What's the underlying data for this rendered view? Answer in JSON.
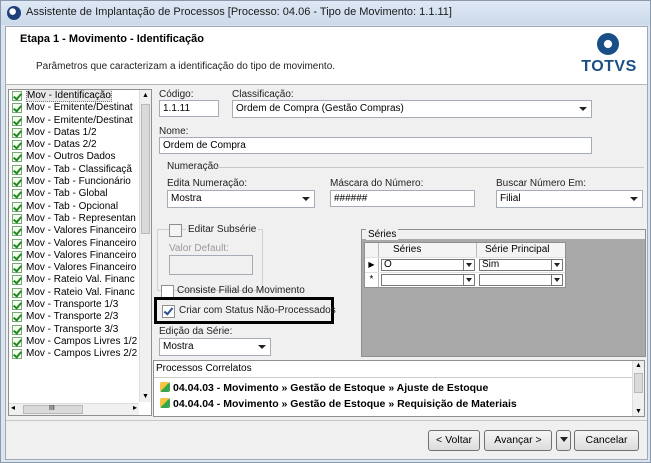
{
  "window": {
    "title": "Assistente de Implantação de Processos [Processo: 04.06 - Tipo de Movimento: 1.1.11]"
  },
  "header": {
    "stage_title": "Etapa 1 - Movimento - Identificação",
    "subtitle": "Parâmetros que caracterizam a identificação do tipo de movimento.",
    "logo_text": "TOTVS"
  },
  "nav": {
    "items": [
      {
        "label": "Mov - Identificação"
      },
      {
        "label": "Mov - Emitente/Destinat"
      },
      {
        "label": "Mov - Emitente/Destinat"
      },
      {
        "label": "Mov - Datas 1/2"
      },
      {
        "label": "Mov - Datas 2/2"
      },
      {
        "label": "Mov - Outros Dados"
      },
      {
        "label": "Mov - Tab - Classificaçã"
      },
      {
        "label": "Mov - Tab - Funcionário"
      },
      {
        "label": "Mov - Tab - Global"
      },
      {
        "label": "Mov - Tab - Opcional"
      },
      {
        "label": "Mov - Tab - Representan"
      },
      {
        "label": "Mov - Valores Financeiro"
      },
      {
        "label": "Mov - Valores Financeiro"
      },
      {
        "label": "Mov - Valores Financeiro"
      },
      {
        "label": "Mov - Valores Financeiro"
      },
      {
        "label": "Mov - Rateio Val. Financ"
      },
      {
        "label": "Mov - Rateio Val. Financ"
      },
      {
        "label": "Mov - Transporte 1/3"
      },
      {
        "label": "Mov - Transporte 2/3"
      },
      {
        "label": "Mov - Transporte 3/3"
      },
      {
        "label": "Mov - Campos Livres 1/2"
      },
      {
        "label": "Mov - Campos Livres 2/2"
      }
    ],
    "hscroll_grip": "III"
  },
  "form": {
    "codigo_label": "Código:",
    "codigo_value": "1.1.11",
    "classificacao_label": "Classificação:",
    "classificacao_value": "Ordem de Compra (Gestão Compras)",
    "nome_label": "Nome:",
    "nome_value": "Ordem de Compra",
    "numeracao_group": "Numeração",
    "edita_label": "Edita Numeração:",
    "edita_value": "Mostra",
    "mascara_label": "Máscara do Número:",
    "mascara_value": "######",
    "buscar_label": "Buscar Número Em:",
    "buscar_value": "Filial",
    "editar_subserie_label": "Editar Subsérie",
    "valor_default_label": "Valor Default:",
    "valor_default_value": "",
    "consiste_label": "Consiste Filial do Movimento",
    "criar_status_label": "Criar com Status Não-Processados",
    "edicao_serie_label": "Edição da Série:",
    "edicao_serie_value": "Mostra"
  },
  "series": {
    "panel_title": "Séries",
    "columns": [
      "Séries",
      "Série Principal"
    ],
    "rows": [
      {
        "marker": "▶",
        "serie": "O",
        "principal": "Sim"
      },
      {
        "marker": "*",
        "serie": "",
        "principal": ""
      }
    ]
  },
  "processos": {
    "title": "Processos Correlatos",
    "lines": [
      "04.04.03 - Movimento » Gestão de Estoque » Ajuste de Estoque",
      "04.04.04 - Movimento » Gestão de Estoque » Requisição de Materiais"
    ]
  },
  "buttons": {
    "voltar": "< Voltar",
    "avancar": "Avançar >",
    "cancelar": "Cancelar"
  },
  "colors": {
    "window_border": "#8a9aab",
    "titlebar": "#cbd9ea",
    "brand": "#1a4f86"
  }
}
